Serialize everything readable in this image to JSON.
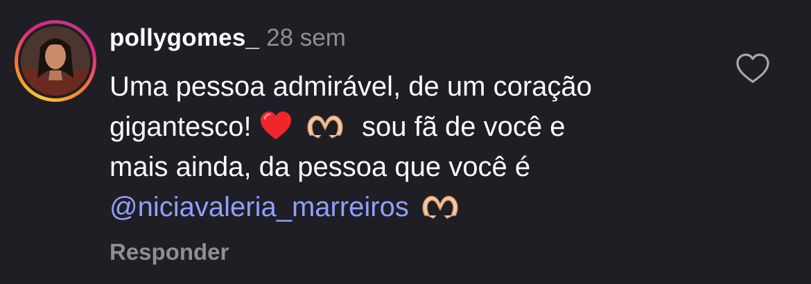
{
  "comment": {
    "username": "pollygomes_",
    "time": "28 sem",
    "text_lines": [
      "Uma pessoa admirável, de um coração",
      "gigantesco!",
      "sou fã de você e",
      "mais ainda, da pessoa que você é"
    ],
    "mention": "@niciavaleria_marreiros",
    "reply_label": "Responder"
  },
  "icons": {
    "like": "heart-outline-icon",
    "emoji_1": "red-heart-emoji",
    "emoji_2": "heart-hands-emoji"
  },
  "colors": {
    "background": "#1f1e25",
    "mention": "#8fa0ff",
    "muted": "#8e8e93",
    "text": "#ffffff"
  }
}
